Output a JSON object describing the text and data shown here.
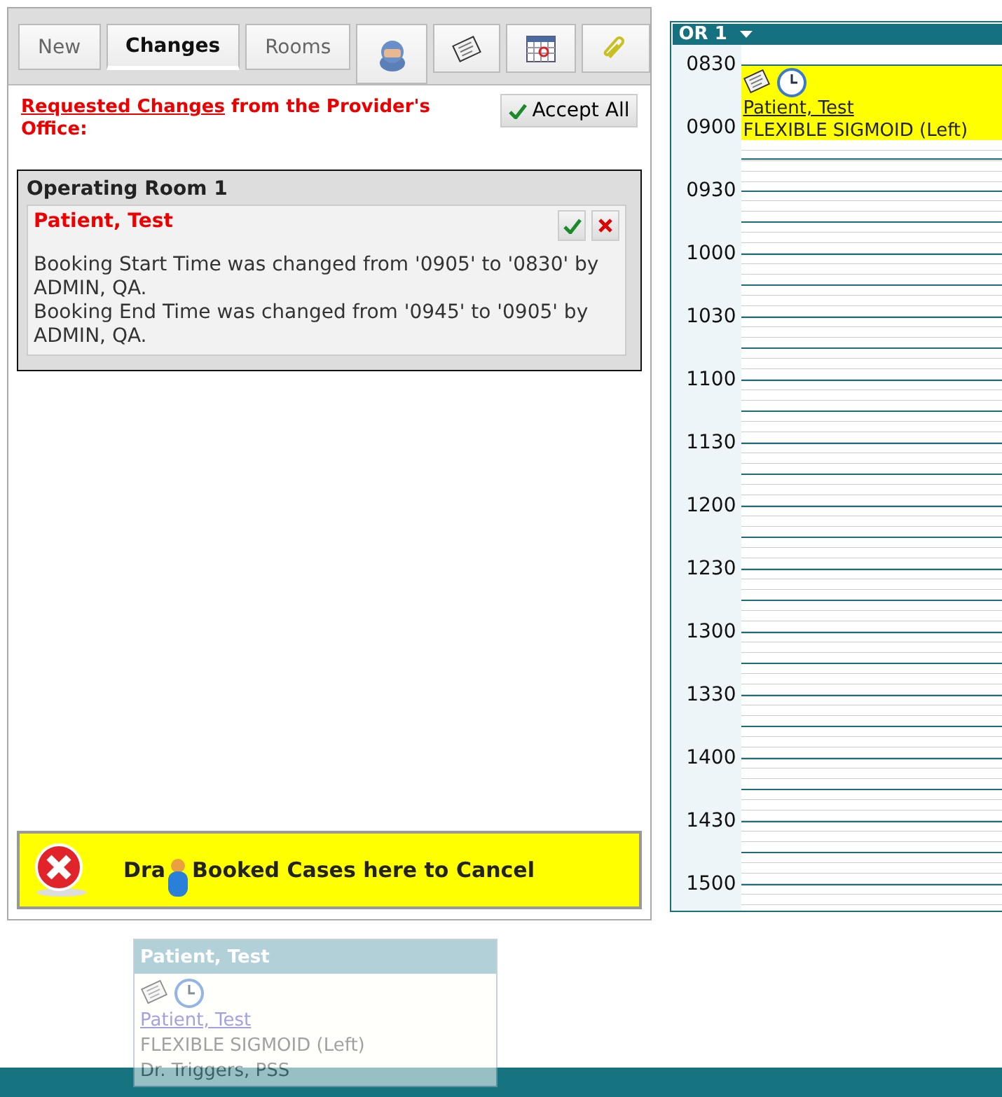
{
  "tabs": [
    {
      "label": "New",
      "selected": false
    },
    {
      "label": "Changes",
      "selected": true
    },
    {
      "label": "Rooms",
      "selected": false
    }
  ],
  "tool_buttons": [
    {
      "kind": "person"
    },
    {
      "kind": "note"
    },
    {
      "kind": "calendar"
    },
    {
      "kind": "paperclip"
    }
  ],
  "heading": {
    "link": "Requested Changes",
    "text": "from the Provider's Office:"
  },
  "accept_all_button": "Accept All",
  "room": {
    "title": "Operating Room 1",
    "changes": [
      {
        "patient": "Patient, Test",
        "messages": [
          "Booking Start Time was changed from '0905' to '0830' by ADMIN, QA.",
          "Booking End Time was changed from '0945' to '0905' by ADMIN, QA."
        ]
      }
    ]
  },
  "cancel_zone": {
    "text_before": "Dra",
    "text_after": "Booked Cases here to Cancel"
  },
  "calendar": {
    "room": "OR 1",
    "times": [
      "0830",
      "0900",
      "0930",
      "1000",
      "1030",
      "1100",
      "1130",
      "1200",
      "1230",
      "1300",
      "1330",
      "1400",
      "1430",
      "1500"
    ],
    "appointments": [
      {
        "patient": "Patient, Test",
        "procedure": "FLEXIBLE SIGMOID (Left)"
      }
    ]
  },
  "drag_preview": {
    "title": "Patient, Test",
    "patient": "Patient, Test",
    "procedure": "FLEXIBLE SIGMOID (Left)",
    "doctor": "Dr. Triggers, PSS"
  }
}
